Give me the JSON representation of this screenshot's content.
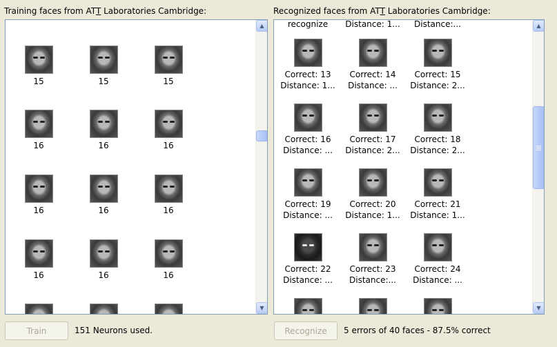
{
  "left_panel": {
    "label_pre": "Training faces from AT",
    "label_u": "T",
    "label_post": " Laboratories Cambridge:"
  },
  "right_panel": {
    "label_pre": "Recognized faces from AT",
    "label_u": "T",
    "label_post": " Laboratories Cambridge:"
  },
  "training_rows": [
    [
      "15",
      "15",
      "15"
    ],
    [
      "16",
      "16",
      "16"
    ],
    [
      "16",
      "16",
      "16"
    ],
    [
      "16",
      "16",
      "16"
    ]
  ],
  "recognized_top_partial": [
    {
      "line1": "recognize"
    },
    {
      "line1": "Distance: 1..."
    },
    {
      "line1": "Distance:..."
    }
  ],
  "recognized_rows": [
    [
      {
        "line1": "Correct: 13",
        "line2": "Distance: 1..."
      },
      {
        "line1": "Correct: 14",
        "line2": "Distance: ..."
      },
      {
        "line1": "Correct: 15",
        "line2": "Distance: 2..."
      }
    ],
    [
      {
        "line1": "Correct: 16",
        "line2": "Distance: ..."
      },
      {
        "line1": "Correct: 17",
        "line2": "Distance: 2..."
      },
      {
        "line1": "Correct: 18",
        "line2": "Distance: 2..."
      }
    ],
    [
      {
        "line1": "Correct: 19",
        "line2": "Distance: ..."
      },
      {
        "line1": "Correct: 20",
        "line2": "Distance: 1..."
      },
      {
        "line1": "Correct: 21",
        "line2": "Distance: 1..."
      }
    ],
    [
      {
        "line1": "Correct: 22",
        "line2": "Distance: ..."
      },
      {
        "line1": "Correct: 23",
        "line2": "Distance:..."
      },
      {
        "line1": "Correct: 24",
        "line2": "Distance: ..."
      }
    ]
  ],
  "buttons": {
    "train": "Train",
    "recognize": "Recognize"
  },
  "status": {
    "neurons": "151 Neurons used.",
    "result": "5 errors of 40 faces - 87.5% correct"
  }
}
